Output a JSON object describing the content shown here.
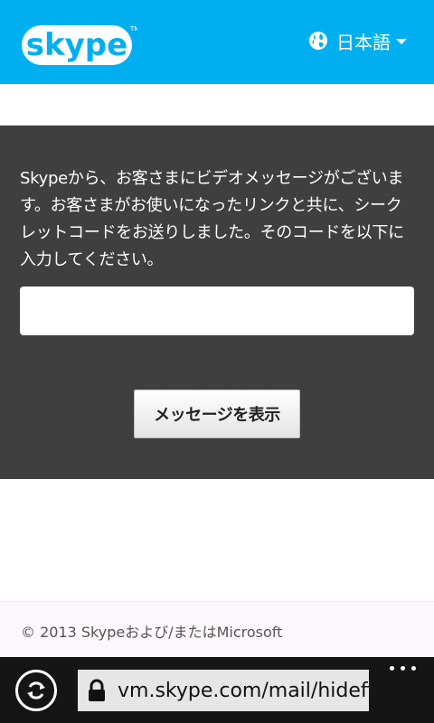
{
  "header": {
    "logo_text": "skype",
    "language_label": "日本語"
  },
  "panel": {
    "message": "Skypeから、お客さまにビデオメッセージがございます。お客さまがお使いになったリンクと共に、シークレットコードをお送りしました。そのコードを以下に入力してください。",
    "code_input_value": "",
    "show_button_label": "メッセージを表示"
  },
  "footer": {
    "copyright": "© 2013 Skypeおよび/またはMicrosoft"
  },
  "browser": {
    "url": "vm.skype.com/mail/hidefinish"
  },
  "colors": {
    "header_bg": "#00aff0",
    "panel_bg": "#3f3f3f",
    "footer_bg": "#fdf8fd",
    "browser_bar_bg": "#151515"
  }
}
